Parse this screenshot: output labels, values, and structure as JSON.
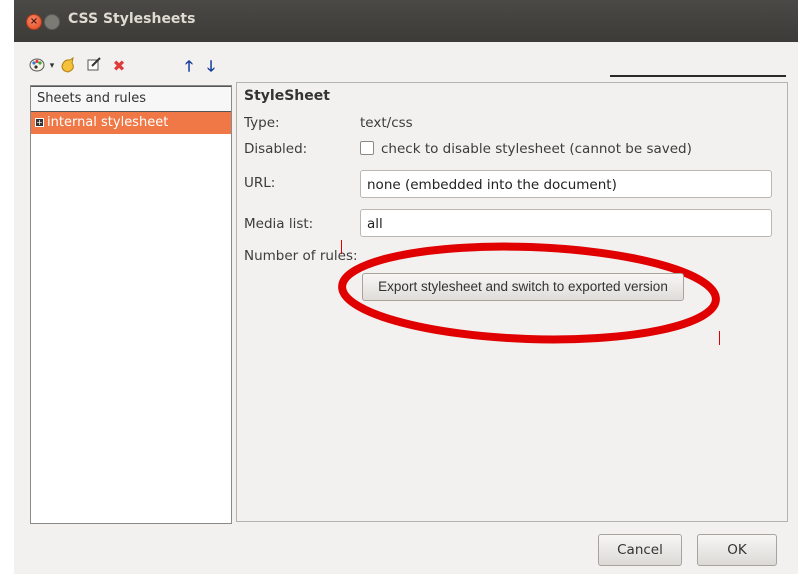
{
  "window": {
    "title": "CSS Stylesheets"
  },
  "toolbar": {
    "icons": [
      "palette-icon",
      "dropdown-arrow-icon",
      "add-stylesheet-icon",
      "edit-icon",
      "delete-icon",
      "move-up-icon",
      "move-down-icon"
    ]
  },
  "sidebar": {
    "header": "Sheets and rules",
    "items": [
      {
        "label": "internal stylesheet",
        "selected": true
      }
    ]
  },
  "details": {
    "heading": "StyleSheet",
    "type_label": "Type:",
    "type_value": "text/css",
    "disabled_label": "Disabled:",
    "disabled_checkbox_label": "check to disable stylesheet (cannot be saved)",
    "url_label": "URL:",
    "url_value": "none (embedded into the document)",
    "media_label": "Media list:",
    "media_value": "all",
    "rules_label": "Number of rules:",
    "export_button": "Export stylesheet and switch to exported version"
  },
  "footer": {
    "cancel_label": "Cancel",
    "ok_label": "OK"
  },
  "colors": {
    "selection": "#f07746",
    "annotation": "#e00000",
    "titlebar": "#3c3b37"
  }
}
